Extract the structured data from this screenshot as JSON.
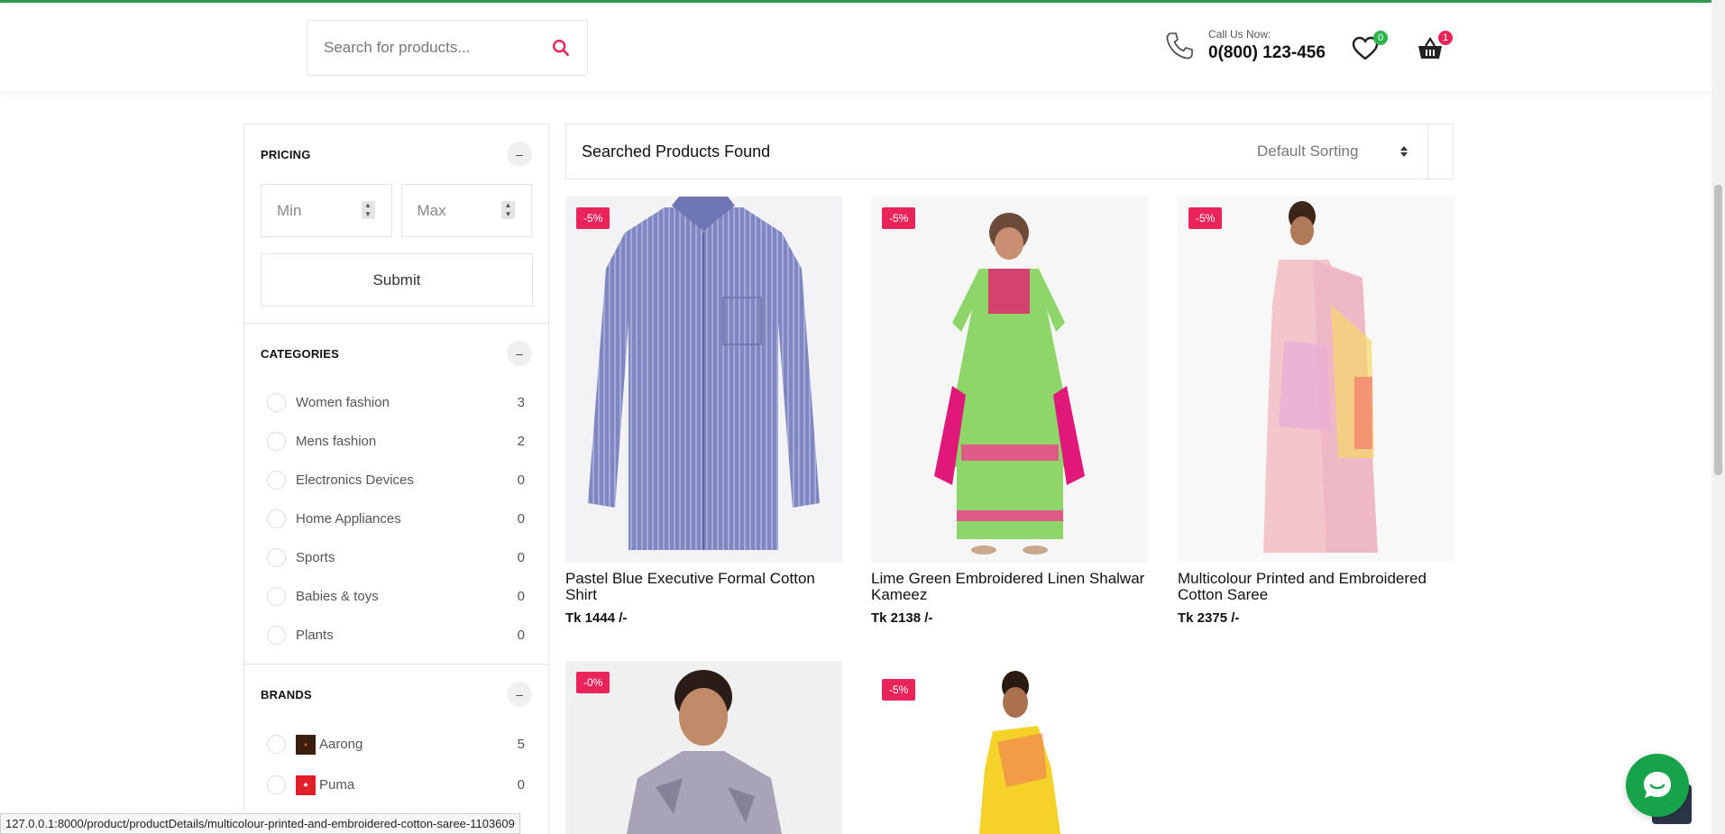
{
  "header": {
    "search_placeholder": "Search for products...",
    "call_label": "Call Us Now:",
    "call_number": "0(800) 123-456",
    "wishlist_count": "0",
    "cart_count": "1"
  },
  "sidebar": {
    "pricing": {
      "title": "PRICING",
      "min_placeholder": "Min",
      "max_placeholder": "Max",
      "submit_label": "Submit"
    },
    "categories": {
      "title": "CATEGORIES",
      "items": [
        {
          "label": "Women fashion",
          "count": "3"
        },
        {
          "label": "Mens fashion",
          "count": "2"
        },
        {
          "label": "Electronics Devices",
          "count": "0"
        },
        {
          "label": "Home Appliances",
          "count": "0"
        },
        {
          "label": "Sports",
          "count": "0"
        },
        {
          "label": "Babies & toys",
          "count": "0"
        },
        {
          "label": "Plants",
          "count": "0"
        }
      ]
    },
    "brands": {
      "title": "BRANDS",
      "items": [
        {
          "label": "Aarong",
          "count": "5"
        },
        {
          "label": "Puma",
          "count": "0"
        }
      ]
    },
    "toggle_symbol": "–"
  },
  "results": {
    "title": "Searched Products Found",
    "sort_selected": "Default Sorting"
  },
  "products": [
    {
      "name": "Pastel Blue Executive Formal Cotton Shirt",
      "price": "Tk 1444 /-",
      "discount": "-5%"
    },
    {
      "name": "Lime Green Embroidered Linen Shalwar Kameez",
      "price": "Tk 2138 /-",
      "discount": "-5%"
    },
    {
      "name": "Multicolour Printed and Embroidered Cotton Saree",
      "price": "Tk 2375 /-",
      "discount": "-5%"
    },
    {
      "name": "",
      "price": "",
      "discount": "-0%"
    },
    {
      "name": "",
      "price": "",
      "discount": "-5%"
    }
  ],
  "status_bar": {
    "url": "127.0.0.1:8000/product/productDetails/multicolour-printed-and-embroidered-cotton-saree-1103609"
  },
  "colors": {
    "accent": "#e8245a",
    "top_line": "#2e9e4f",
    "chat": "#16a34a"
  }
}
